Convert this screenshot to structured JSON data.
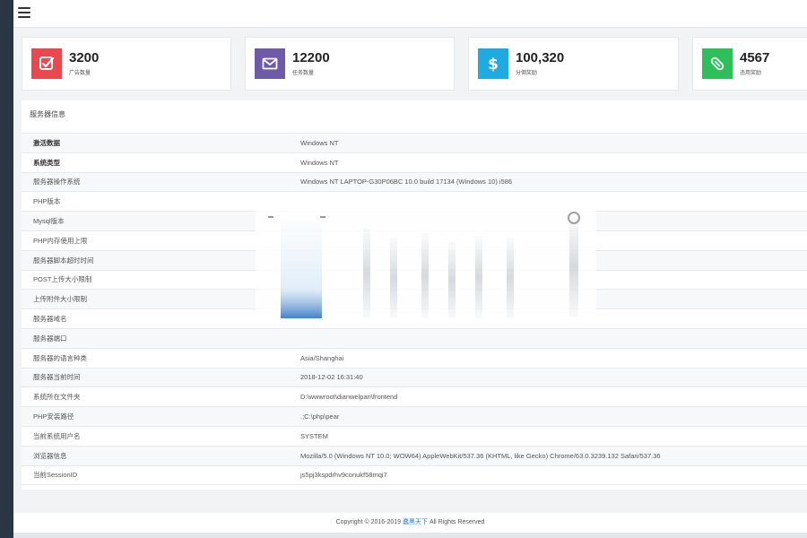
{
  "stats": [
    {
      "value": "3200",
      "label": "广告数量",
      "color": "#e9484e",
      "icon": "checkbox-icon"
    },
    {
      "value": "12200",
      "label": "任务数量",
      "color": "#6f5aa8",
      "icon": "envelope-icon"
    },
    {
      "value": "100,320",
      "label": "分佣奖励",
      "color": "#21a9e1",
      "icon": "dollar-icon"
    },
    {
      "value": "4567",
      "label": "违用奖励",
      "color": "#2fbe5c",
      "icon": "paperclip-icon"
    }
  ],
  "panel": {
    "title": "服务器信息",
    "rows": [
      {
        "key": "激活数据",
        "value": "Windows NT"
      },
      {
        "key": "系统类型",
        "value": "Windows NT"
      },
      {
        "key": "服务器操作系统",
        "value": "Windows NT LAPTOP-G30P06BC 10.0 build 17134 (Windows 10) i586"
      },
      {
        "key": "PHP版本",
        "value": ""
      },
      {
        "key": "Mysql版本",
        "value": ""
      },
      {
        "key": "PHP内存使用上限",
        "value": ""
      },
      {
        "key": "服务器脚本超时时间",
        "value": ""
      },
      {
        "key": "POST上传大小限制",
        "value": ""
      },
      {
        "key": "上传附件大小限制",
        "value": ""
      },
      {
        "key": "服务器域名",
        "value": ""
      },
      {
        "key": "服务器端口",
        "value": ""
      },
      {
        "key": "服务器的语言种类",
        "value": "Asia/Shanghai"
      },
      {
        "key": "服务器当前时间",
        "value": "2018-12-02 16:31:40"
      },
      {
        "key": "系统所在文件夹",
        "value": "D:\\wwwroot\\dianwelpan\\frontend"
      },
      {
        "key": "PHP安装路径",
        "value": ".;C:\\php\\pear"
      },
      {
        "key": "当前系统用户名",
        "value": "SYSTEM"
      },
      {
        "key": "浏览器信息",
        "value": "Mozilla/5.0 (Windows NT 10.0; WOW64) AppleWebKit/537.36 (KHTML, like Gecko) Chrome/63.0.3239.132 Safari/537.36"
      },
      {
        "key": "当前SessionID",
        "value": "js5pj3kspdrhv9conukf58mqi7"
      }
    ]
  },
  "footer": {
    "prefix": "Copyright © 2016-2019",
    "link": "蠢黑天下",
    "suffix": "All Rights Reserved"
  }
}
